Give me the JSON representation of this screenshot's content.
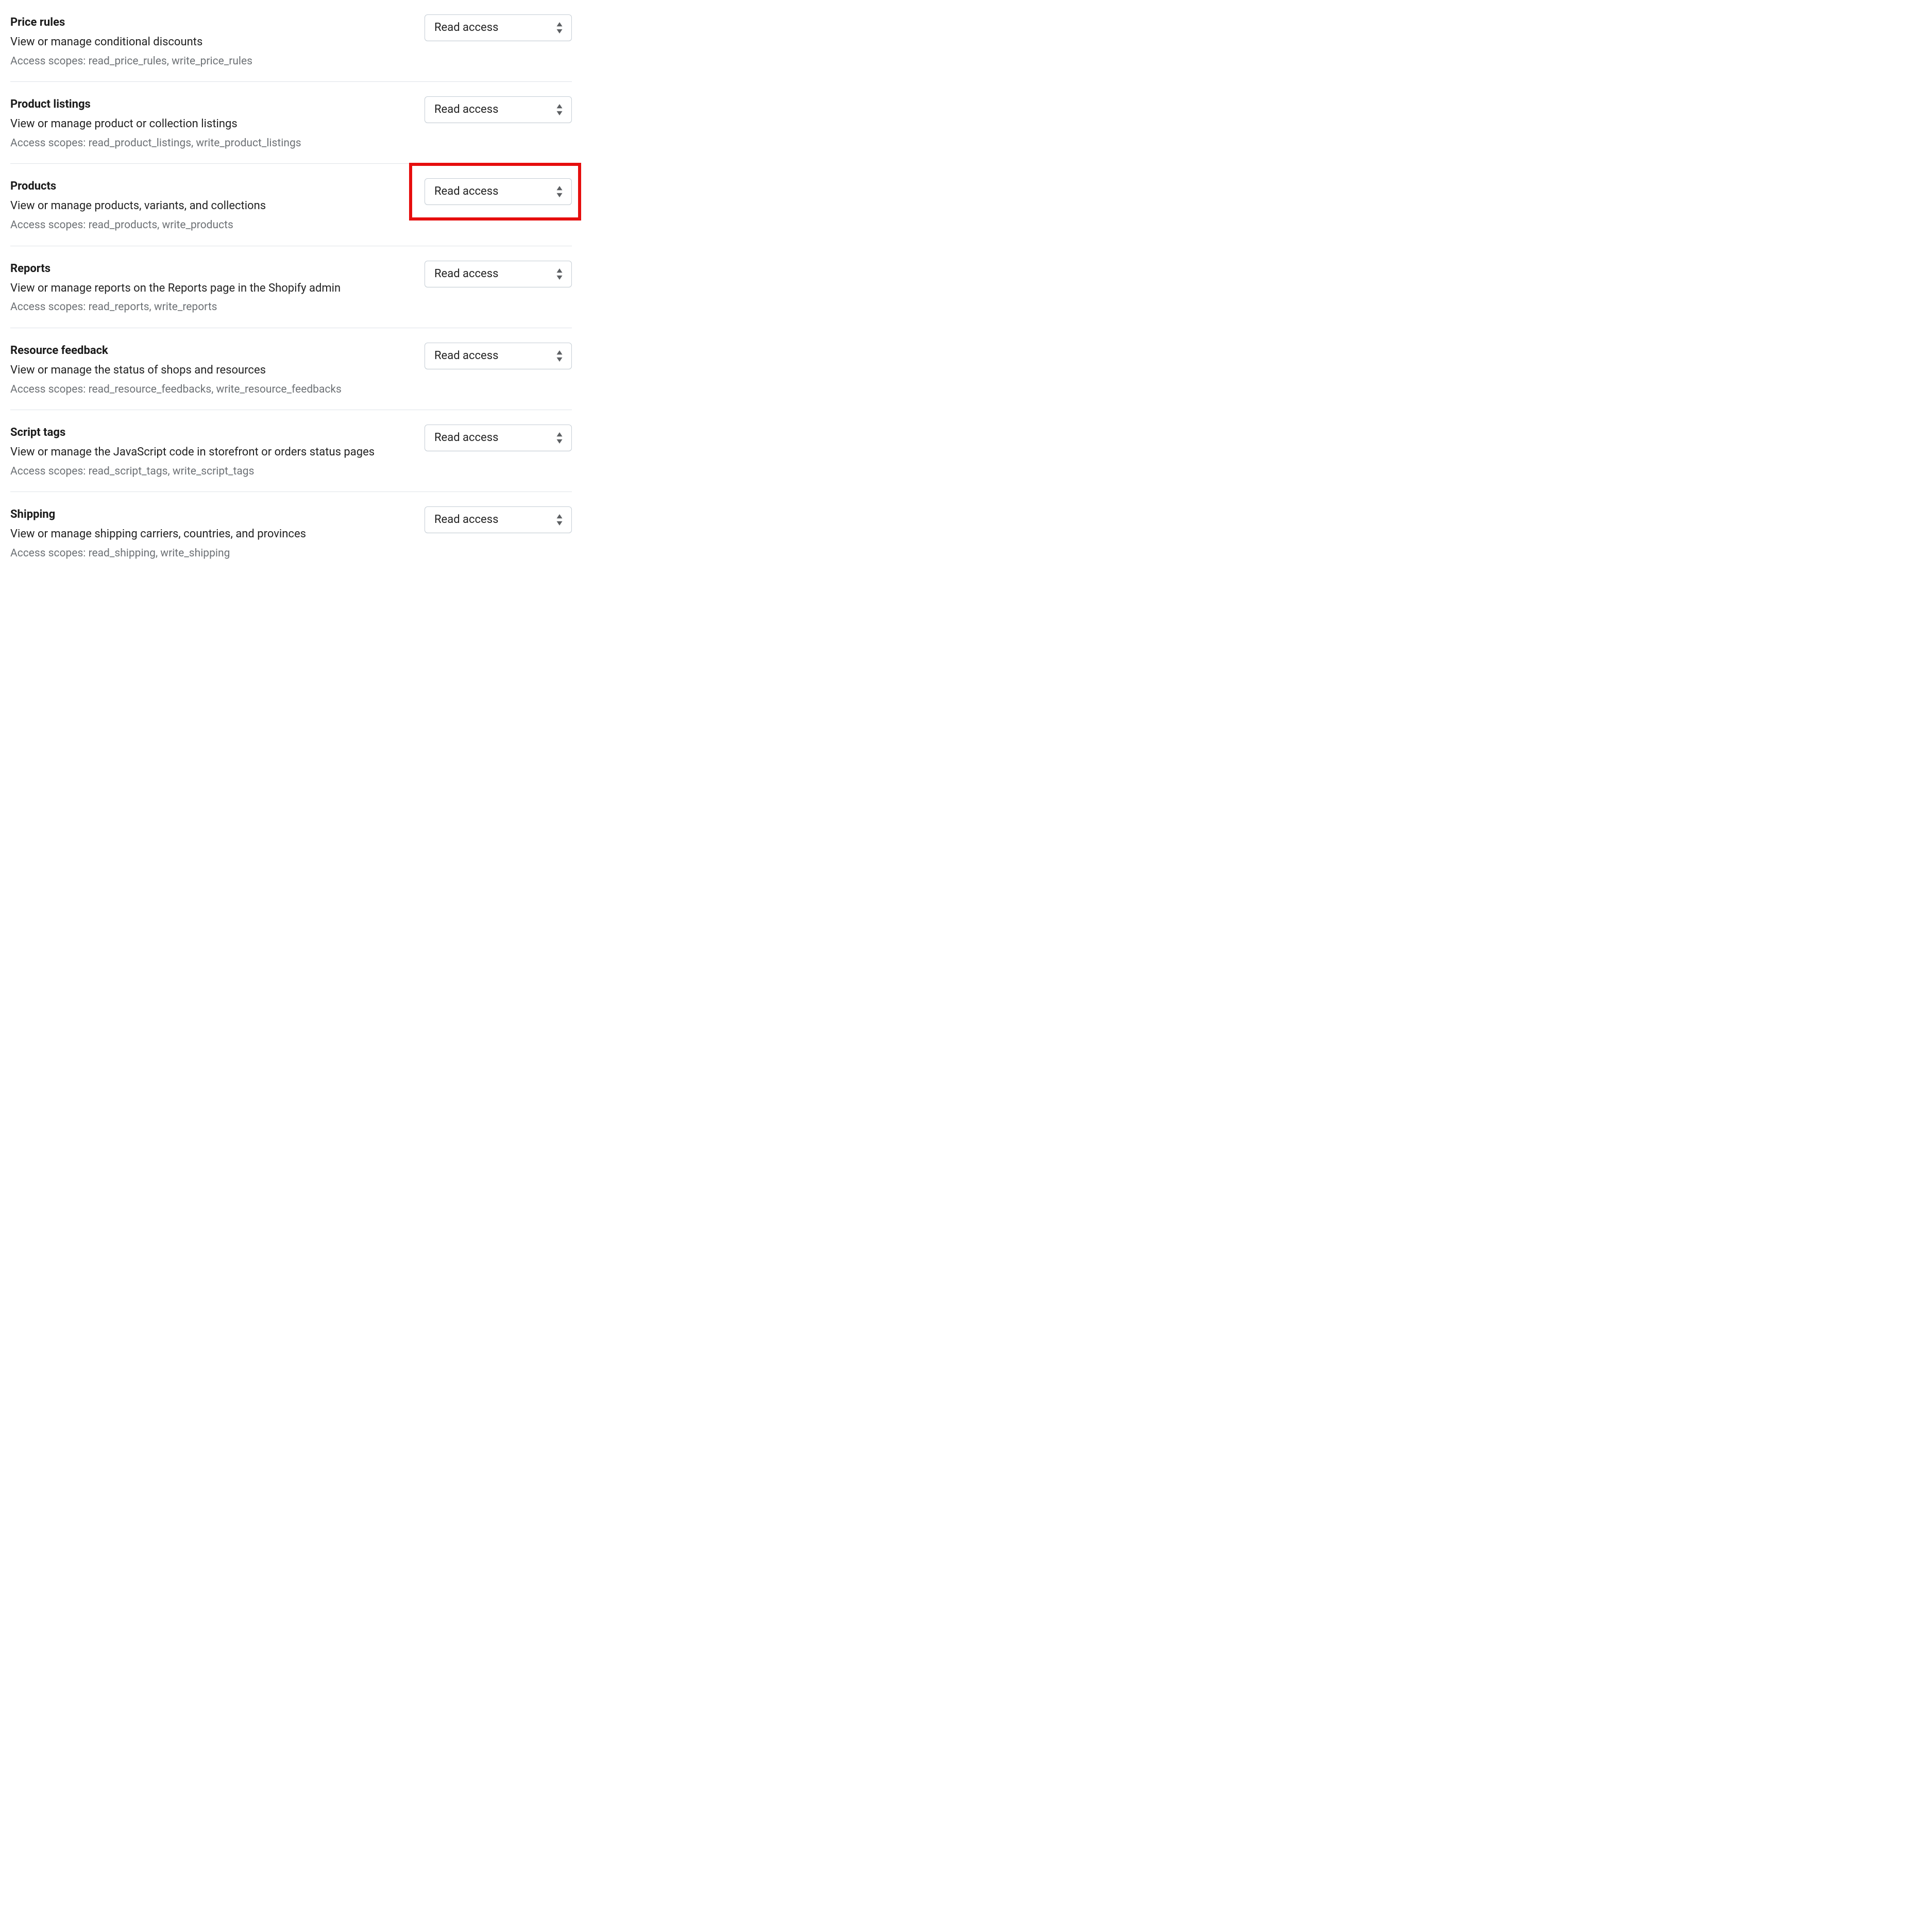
{
  "select_value": "Read access",
  "rows": [
    {
      "id": "price-rules",
      "title": "Price rules",
      "desc": "View or manage conditional discounts",
      "scopes": "Access scopes: read_price_rules, write_price_rules",
      "highlight": false
    },
    {
      "id": "product-listings",
      "title": "Product listings",
      "desc": "View or manage product or collection listings",
      "scopes": "Access scopes: read_product_listings, write_product_listings",
      "highlight": false
    },
    {
      "id": "products",
      "title": "Products",
      "desc": "View or manage products, variants, and collections",
      "scopes": "Access scopes: read_products, write_products",
      "highlight": true
    },
    {
      "id": "reports",
      "title": "Reports",
      "desc": "View or manage reports on the Reports page in the Shopify admin",
      "scopes": "Access scopes: read_reports, write_reports",
      "highlight": false
    },
    {
      "id": "resource-feedback",
      "title": "Resource feedback",
      "desc": "View or manage the status of shops and resources",
      "scopes": "Access scopes: read_resource_feedbacks, write_resource_feedbacks",
      "highlight": false
    },
    {
      "id": "script-tags",
      "title": "Script tags",
      "desc": "View or manage the JavaScript code in storefront or orders status pages",
      "scopes": "Access scopes: read_script_tags, write_script_tags",
      "highlight": false
    },
    {
      "id": "shipping",
      "title": "Shipping",
      "desc": "View or manage shipping carriers, countries, and provinces",
      "scopes": "Access scopes: read_shipping, write_shipping",
      "highlight": false
    }
  ]
}
